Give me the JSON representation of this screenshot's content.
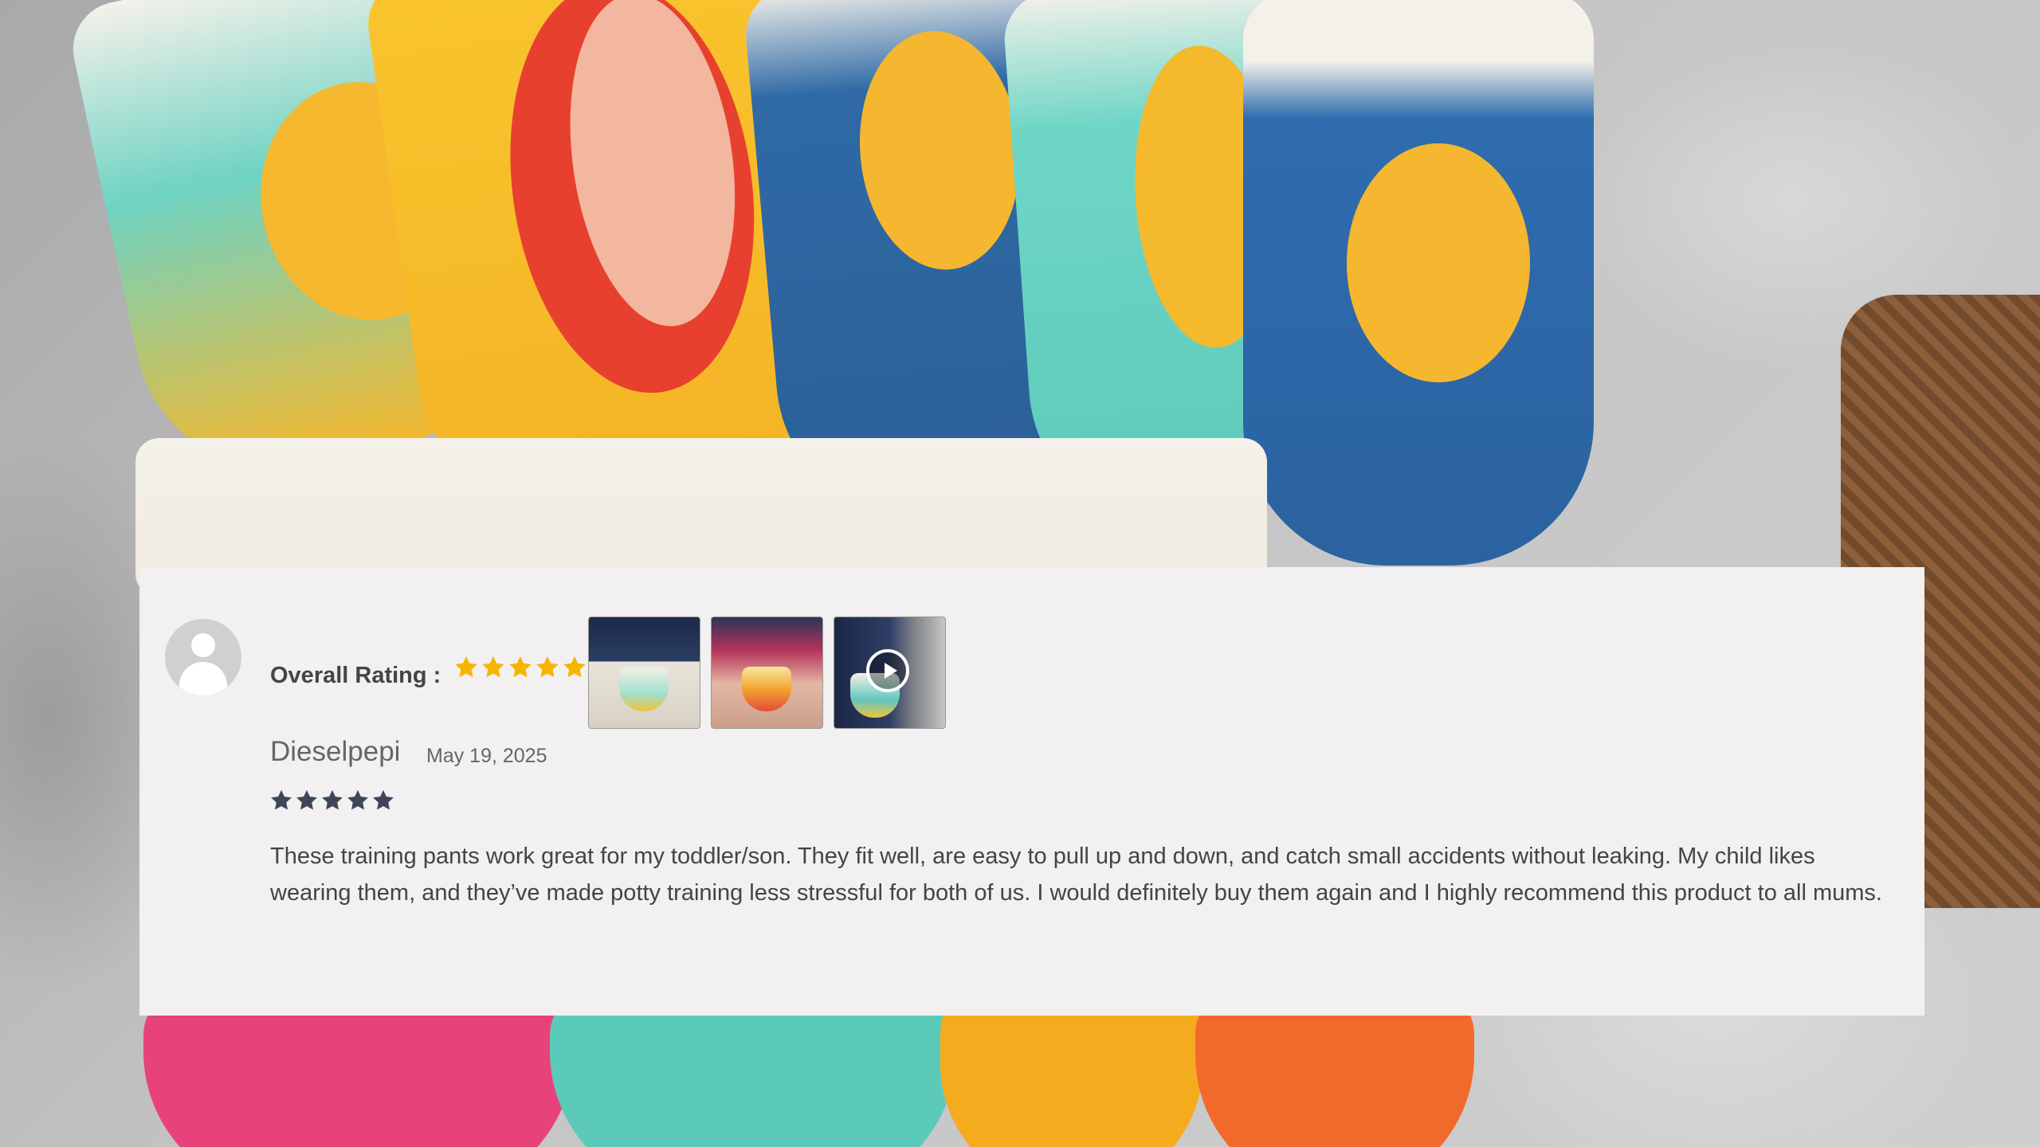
{
  "review": {
    "overall_label": "Overall Rating :",
    "overall_stars": 5,
    "reviewer_name": "Dieselpepi",
    "date": "May 19, 2025",
    "rating_stars": 5,
    "text": "These training pants work great for my toddler/son. They fit well, are easy to pull up and down, and catch small accidents without leaking. My child likes wearing them, and they’ve made potty training less stressful for both of us. I would definitely buy them again and I highly recommend this product to all mums.",
    "media": [
      {
        "type": "photo",
        "icon": "photo-thumbnail"
      },
      {
        "type": "photo",
        "icon": "photo-thumbnail"
      },
      {
        "type": "video",
        "icon": "play-icon"
      }
    ]
  },
  "colors": {
    "gold_star": "#f7b500",
    "dark_star": "#3f4658",
    "card_bg": "#f2f0f1"
  }
}
